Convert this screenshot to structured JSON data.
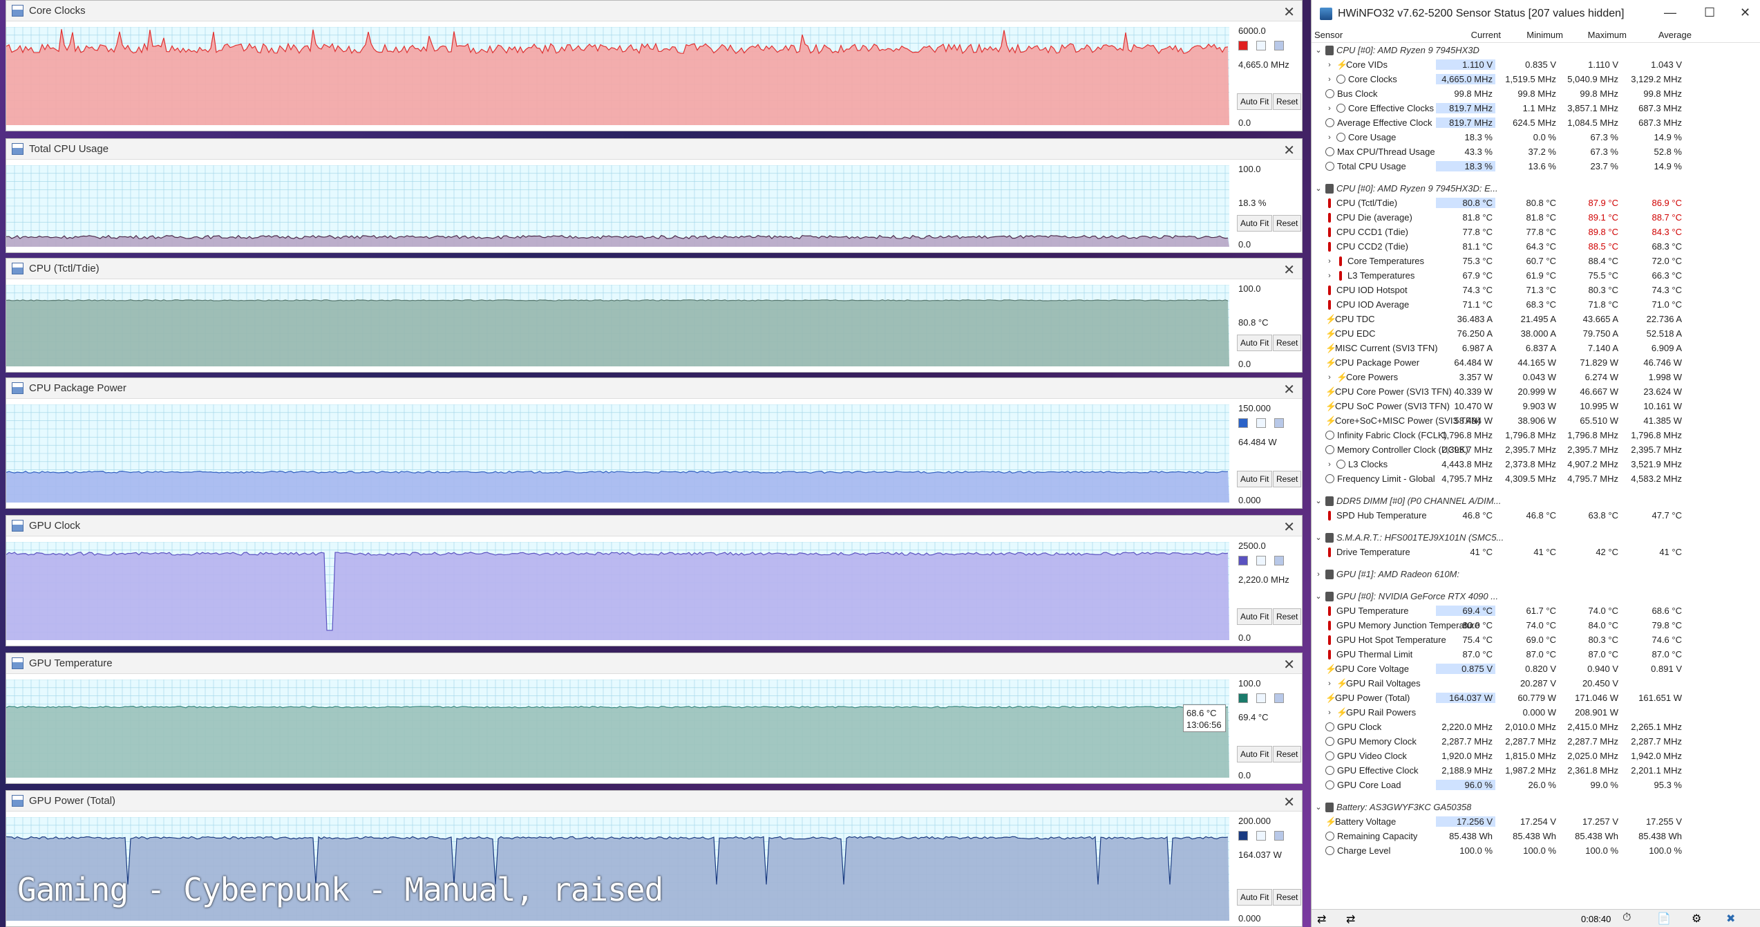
{
  "graphs": [
    {
      "title": "Core Clocks",
      "max": "6000.0",
      "current": "4,665.0 MHz",
      "min": "0.0",
      "fill": "#f4a6a6",
      "line": "#e03030",
      "swatch": "#e02020",
      "swatches": true,
      "level": 0.78,
      "noise": 0.05
    },
    {
      "title": "Total CPU Usage",
      "max": "100.0",
      "current": "18.3 %",
      "min": "0.0",
      "fill": "#b9a7c7",
      "line": "#4a2a4a",
      "swatch": "",
      "swatches": false,
      "level": 0.12,
      "noise": 0.02
    },
    {
      "title": "CPU (Tctl/Tdie)",
      "max": "100.0",
      "current": "80.8 °C",
      "min": "0.0",
      "fill": "#98b8b0",
      "line": "#5a7a72",
      "swatch": "",
      "swatches": false,
      "level": 0.81,
      "noise": 0.006
    },
    {
      "title": "CPU Package Power",
      "max": "150.000",
      "current": "64.484 W",
      "min": "0.000",
      "fill": "#a7b8f0",
      "line": "#3060c0",
      "swatch": "#2a62c8",
      "swatches": true,
      "level": 0.31,
      "noise": 0.01
    },
    {
      "title": "GPU Clock",
      "max": "2500.0",
      "current": "2,220.0 MHz",
      "min": "0.0",
      "fill": "#b7b3ef",
      "line": "#5a52c0",
      "swatch": "#5a52c0",
      "swatches": true,
      "level": 0.88,
      "noise": 0.015
    },
    {
      "title": "GPU Temperature",
      "max": "100.0",
      "current": "69.4 °C",
      "min": "0.0",
      "fill": "#9cc2bc",
      "line": "#3a8a80",
      "swatch": "#1a7a6a",
      "swatches": true,
      "level": 0.72,
      "noise": 0.008
    },
    {
      "title": "GPU Power (Total)",
      "max": "200.000",
      "current": "164.037 W",
      "min": "0.000",
      "fill": "#a2b4d6",
      "line": "#1a3a80",
      "swatch": "#1a3a80",
      "swatches": true,
      "level": 0.8,
      "noise": 0.012
    }
  ],
  "buttons": {
    "autofit": "Auto Fit",
    "reset": "Reset"
  },
  "tooltip": {
    "value": "68.6 °C",
    "time": "13:06:56"
  },
  "caption": "Gaming - Cyberpunk - Manual, raised",
  "hwinfo": {
    "title": "HWiNFO32 v7.62-5200 Sensor Status [207 values hidden]",
    "columns": [
      "Sensor",
      "Current",
      "Minimum",
      "Maximum",
      "Average"
    ],
    "status_time": "0:08:40",
    "rows": [
      {
        "t": "hdr",
        "icon": "chip",
        "name": "CPU [#0]: AMD Ryzen 9 7945HX3D"
      },
      {
        "t": "row",
        "exp": ">",
        "icon": "bolt",
        "name": "Core VIDs",
        "ind": 1,
        "v": [
          "1.110 V",
          "0.835 V",
          "1.110 V",
          "1.043 V"
        ],
        "hl": true
      },
      {
        "t": "row",
        "exp": ">",
        "icon": "clock",
        "name": "Core Clocks",
        "ind": 1,
        "v": [
          "4,665.0 MHz",
          "1,519.5 MHz",
          "5,040.9 MHz",
          "3,129.2 MHz"
        ],
        "hl": true
      },
      {
        "t": "row",
        "icon": "clock",
        "name": "Bus Clock",
        "v": [
          "99.8 MHz",
          "99.8 MHz",
          "99.8 MHz",
          "99.8 MHz"
        ]
      },
      {
        "t": "row",
        "exp": ">",
        "icon": "clock",
        "name": "Core Effective Clocks",
        "ind": 1,
        "v": [
          "819.7 MHz",
          "1.1 MHz",
          "3,857.1 MHz",
          "687.3 MHz"
        ],
        "hl": true
      },
      {
        "t": "row",
        "icon": "clock",
        "name": "Average Effective Clock",
        "v": [
          "819.7 MHz",
          "624.5 MHz",
          "1,084.5 MHz",
          "687.3 MHz"
        ],
        "hl": true
      },
      {
        "t": "row",
        "exp": ">",
        "icon": "clock",
        "name": "Core Usage",
        "ind": 1,
        "v": [
          "18.3 %",
          "0.0 %",
          "67.3 %",
          "14.9 %"
        ]
      },
      {
        "t": "row",
        "icon": "clock",
        "name": "Max CPU/Thread Usage",
        "v": [
          "43.3 %",
          "37.2 %",
          "67.3 %",
          "52.8 %"
        ]
      },
      {
        "t": "row",
        "icon": "clock",
        "name": "Total CPU Usage",
        "v": [
          "18.3 %",
          "13.6 %",
          "23.7 %",
          "14.9 %"
        ],
        "hl": true
      },
      {
        "t": "gap"
      },
      {
        "t": "hdr",
        "icon": "chip",
        "name": "CPU [#0]: AMD Ryzen 9 7945HX3D: E..."
      },
      {
        "t": "row",
        "icon": "therm",
        "name": "CPU (Tctl/Tdie)",
        "v": [
          "80.8 °C",
          "80.8 °C",
          "87.9 °C",
          "86.9 °C"
        ],
        "hl": true,
        "red": [
          2,
          3
        ]
      },
      {
        "t": "row",
        "icon": "therm",
        "name": "CPU Die (average)",
        "v": [
          "81.8 °C",
          "81.8 °C",
          "89.1 °C",
          "88.7 °C"
        ],
        "red": [
          2,
          3
        ]
      },
      {
        "t": "row",
        "icon": "therm",
        "name": "CPU CCD1 (Tdie)",
        "v": [
          "77.8 °C",
          "77.8 °C",
          "89.8 °C",
          "84.3 °C"
        ],
        "red": [
          2,
          3
        ]
      },
      {
        "t": "row",
        "icon": "therm",
        "name": "CPU CCD2 (Tdie)",
        "v": [
          "81.1 °C",
          "64.3 °C",
          "88.5 °C",
          "68.3 °C"
        ],
        "red": [
          2
        ]
      },
      {
        "t": "row",
        "exp": ">",
        "icon": "therm",
        "name": "Core Temperatures",
        "ind": 1,
        "v": [
          "75.3 °C",
          "60.7 °C",
          "88.4 °C",
          "72.0 °C"
        ]
      },
      {
        "t": "row",
        "exp": ">",
        "icon": "therm",
        "name": "L3 Temperatures",
        "ind": 1,
        "v": [
          "67.9 °C",
          "61.9 °C",
          "75.5 °C",
          "66.3 °C"
        ]
      },
      {
        "t": "row",
        "icon": "therm",
        "name": "CPU IOD Hotspot",
        "v": [
          "74.3 °C",
          "71.3 °C",
          "80.3 °C",
          "74.3 °C"
        ]
      },
      {
        "t": "row",
        "icon": "therm",
        "name": "CPU IOD Average",
        "v": [
          "71.1 °C",
          "68.3 °C",
          "71.8 °C",
          "71.0 °C"
        ]
      },
      {
        "t": "row",
        "icon": "bolt",
        "name": "CPU TDC",
        "v": [
          "36.483 A",
          "21.495 A",
          "43.665 A",
          "22.736 A"
        ]
      },
      {
        "t": "row",
        "icon": "bolt",
        "name": "CPU EDC",
        "v": [
          "76.250 A",
          "38.000 A",
          "79.750 A",
          "52.518 A"
        ]
      },
      {
        "t": "row",
        "icon": "bolt",
        "name": "MISC Current (SVI3 TFN)",
        "v": [
          "6.987 A",
          "6.837 A",
          "7.140 A",
          "6.909 A"
        ]
      },
      {
        "t": "row",
        "icon": "bolt",
        "name": "CPU Package Power",
        "v": [
          "64.484 W",
          "44.165 W",
          "71.829 W",
          "46.746 W"
        ]
      },
      {
        "t": "row",
        "exp": ">",
        "icon": "bolt",
        "name": "Core Powers",
        "ind": 1,
        "v": [
          "3.357 W",
          "0.043 W",
          "6.274 W",
          "1.998 W"
        ]
      },
      {
        "t": "row",
        "icon": "bolt",
        "name": "CPU Core Power (SVI3 TFN)",
        "v": [
          "40.339 W",
          "20.999 W",
          "46.667 W",
          "23.624 W"
        ]
      },
      {
        "t": "row",
        "icon": "bolt",
        "name": "CPU SoC Power (SVI3 TFN)",
        "v": [
          "10.470 W",
          "9.903 W",
          "10.995 W",
          "10.161 W"
        ]
      },
      {
        "t": "row",
        "icon": "bolt",
        "name": "Core+SoC+MISC Power (SVI3 TFN)",
        "v": [
          "58.494 W",
          "38.906 W",
          "65.510 W",
          "41.385 W"
        ]
      },
      {
        "t": "row",
        "icon": "clock",
        "name": "Infinity Fabric Clock (FCLK)",
        "v": [
          "1,796.8 MHz",
          "1,796.8 MHz",
          "1,796.8 MHz",
          "1,796.8 MHz"
        ]
      },
      {
        "t": "row",
        "icon": "clock",
        "name": "Memory Controller Clock (UCLK)",
        "v": [
          "2,395.7 MHz",
          "2,395.7 MHz",
          "2,395.7 MHz",
          "2,395.7 MHz"
        ]
      },
      {
        "t": "row",
        "exp": ">",
        "icon": "clock",
        "name": "L3 Clocks",
        "ind": 1,
        "v": [
          "4,443.8 MHz",
          "2,373.8 MHz",
          "4,907.2 MHz",
          "3,521.9 MHz"
        ]
      },
      {
        "t": "row",
        "icon": "clock",
        "name": "Frequency Limit - Global",
        "v": [
          "4,795.7 MHz",
          "4,309.5 MHz",
          "4,795.7 MHz",
          "4,583.2 MHz"
        ]
      },
      {
        "t": "gap"
      },
      {
        "t": "hdr",
        "icon": "chip",
        "name": "DDR5 DIMM [#0] (P0 CHANNEL A/DIM..."
      },
      {
        "t": "row",
        "icon": "therm",
        "name": "SPD Hub Temperature",
        "v": [
          "46.8 °C",
          "46.8 °C",
          "63.8 °C",
          "47.7 °C"
        ]
      },
      {
        "t": "gap"
      },
      {
        "t": "hdr",
        "icon": "chip",
        "name": "S.M.A.R.T.: HFS001TEJ9X101N (SMC5..."
      },
      {
        "t": "row",
        "icon": "therm",
        "name": "Drive Temperature",
        "v": [
          "41 °C",
          "41 °C",
          "42 °C",
          "41 °C"
        ]
      },
      {
        "t": "gap"
      },
      {
        "t": "hdr",
        "exp": ">",
        "icon": "chip",
        "name": "GPU [#1]: AMD Radeon 610M:"
      },
      {
        "t": "gap"
      },
      {
        "t": "hdr",
        "icon": "chip",
        "name": "GPU [#0]: NVIDIA GeForce RTX 4090 ..."
      },
      {
        "t": "row",
        "icon": "therm",
        "name": "GPU Temperature",
        "v": [
          "69.4 °C",
          "61.7 °C",
          "74.0 °C",
          "68.6 °C"
        ],
        "hl": true
      },
      {
        "t": "row",
        "icon": "therm",
        "name": "GPU Memory Junction Temperature",
        "v": [
          "80.0 °C",
          "74.0 °C",
          "84.0 °C",
          "79.8 °C"
        ]
      },
      {
        "t": "row",
        "icon": "therm",
        "name": "GPU Hot Spot Temperature",
        "v": [
          "75.4 °C",
          "69.0 °C",
          "80.3 °C",
          "74.6 °C"
        ]
      },
      {
        "t": "row",
        "icon": "therm",
        "name": "GPU Thermal Limit",
        "v": [
          "87.0 °C",
          "87.0 °C",
          "87.0 °C",
          "87.0 °C"
        ]
      },
      {
        "t": "row",
        "icon": "bolt",
        "name": "GPU Core Voltage",
        "v": [
          "0.875 V",
          "0.820 V",
          "0.940 V",
          "0.891 V"
        ],
        "hl": true
      },
      {
        "t": "row",
        "exp": ">",
        "icon": "bolt",
        "name": "GPU Rail Voltages",
        "ind": 1,
        "v": [
          "",
          "20.287 V",
          "20.450 V",
          ""
        ]
      },
      {
        "t": "row",
        "icon": "bolt",
        "name": "GPU Power (Total)",
        "v": [
          "164.037 W",
          "60.779 W",
          "171.046 W",
          "161.651 W"
        ],
        "hl": true
      },
      {
        "t": "row",
        "exp": ">",
        "icon": "bolt",
        "name": "GPU Rail Powers",
        "ind": 1,
        "v": [
          "",
          "0.000 W",
          "208.901 W",
          ""
        ]
      },
      {
        "t": "row",
        "icon": "clock",
        "name": "GPU Clock",
        "v": [
          "2,220.0 MHz",
          "2,010.0 MHz",
          "2,415.0 MHz",
          "2,265.1 MHz"
        ]
      },
      {
        "t": "row",
        "icon": "clock",
        "name": "GPU Memory Clock",
        "v": [
          "2,287.7 MHz",
          "2,287.7 MHz",
          "2,287.7 MHz",
          "2,287.7 MHz"
        ]
      },
      {
        "t": "row",
        "icon": "clock",
        "name": "GPU Video Clock",
        "v": [
          "1,920.0 MHz",
          "1,815.0 MHz",
          "2,025.0 MHz",
          "1,942.0 MHz"
        ]
      },
      {
        "t": "row",
        "icon": "clock",
        "name": "GPU Effective Clock",
        "v": [
          "2,188.9 MHz",
          "1,987.2 MHz",
          "2,361.8 MHz",
          "2,201.1 MHz"
        ]
      },
      {
        "t": "row",
        "icon": "clock",
        "name": "GPU Core Load",
        "v": [
          "96.0 %",
          "26.0 %",
          "99.0 %",
          "95.3 %"
        ],
        "hl": true
      },
      {
        "t": "gap"
      },
      {
        "t": "hdr",
        "icon": "chip",
        "name": "Battery: AS3GWYF3KC GA50358"
      },
      {
        "t": "row",
        "icon": "bolt",
        "name": "Battery Voltage",
        "v": [
          "17.256 V",
          "17.254 V",
          "17.257 V",
          "17.255 V"
        ],
        "hl": true
      },
      {
        "t": "row",
        "icon": "clock",
        "name": "Remaining Capacity",
        "v": [
          "85.438 Wh",
          "85.438 Wh",
          "85.438 Wh",
          "85.438 Wh"
        ]
      },
      {
        "t": "row",
        "icon": "clock",
        "name": "Charge Level",
        "v": [
          "100.0 %",
          "100.0 %",
          "100.0 %",
          "100.0 %"
        ]
      }
    ]
  }
}
